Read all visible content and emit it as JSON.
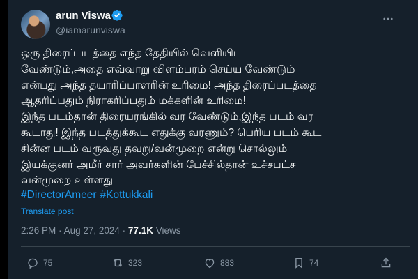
{
  "author": {
    "name": "arun Viswa",
    "handle": "@iamarunviswa"
  },
  "tweet": {
    "lines": [
      "ஒரு திரைப்படத்தை எந்த தேதியில் வெளியிட",
      "வேண்டும்,அதை எவ்வாறு விளம்பரம் செய்ய வேண்டும்",
      "என்பது அந்த தயாரிப்பாளரின் உரிமை! அந்த திரைப்படத்தை",
      "ஆதரிப்பதும் நிராகரிப்பதும் மக்களின் உரிமை!",
      "இந்த படம்தான் திரையரங்கில் வர  வேண்டும்,இந்த படம் வர",
      "கூடாது! இந்த படத்துக்கூட எதுக்கு வரணும்? பெரிய படம் கூட",
      "சின்ன படம் வருவது தவறு/வன்முறை என்று சொல்லும்",
      "இயக்குனர் அமீர் சார் அவர்களின் பேச்சில்தான்  உச்சபட்ச",
      "வன்முறை உள்ளது"
    ],
    "hashtags": [
      "#DirectorAmeer",
      "#Kottukkali"
    ],
    "translate_label": "Translate post",
    "time": "2:26 PM",
    "separator": "·",
    "date": "Aug 27, 2024",
    "views_count": "77.1K",
    "views_label": "Views"
  },
  "actions": {
    "replies": "75",
    "reposts": "323",
    "likes": "883",
    "bookmarks": "74"
  },
  "colors": {
    "background": "#15202b",
    "accent": "#1d9bf0",
    "muted": "#8b98a5"
  }
}
